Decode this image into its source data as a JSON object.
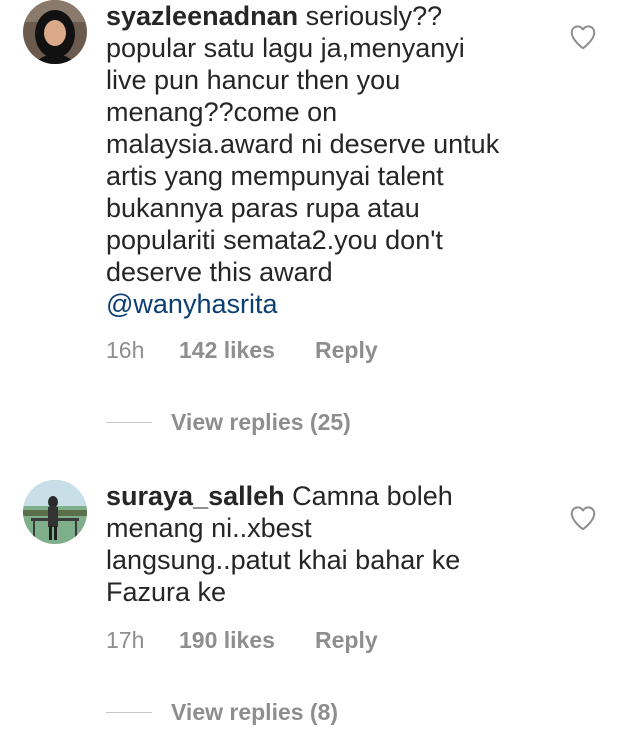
{
  "comments": [
    {
      "username": "syazleenadnan",
      "text": "seriously?? popular satu lagu ja,menyanyi live pun hancur then you menang??come on malaysia.award ni deserve untuk artis yang mempunyai talent bukannya paras rupa atau populariti semata2.you don't deserve this award",
      "lines": [
        "popular satu lagu ja,menyanyi",
        "live pun hancur then you",
        "menang??come on",
        "malaysia.award ni deserve untuk",
        "artis yang mempunyai talent",
        "bukannya paras rupa atau",
        "populariti semata2.you don't",
        "deserve this award"
      ],
      "first_line": "seriously??",
      "mention": "@wanyhasrita",
      "time": "16h",
      "likes": "142 likes",
      "reply_label": "Reply",
      "view_replies": "View replies (25)",
      "like_icon": "heart-outline-icon"
    },
    {
      "username": "suraya_salleh",
      "first_line": "Camna boleh",
      "lines": [
        "menang ni..xbest",
        "langsung..patut khai bahar ke",
        "Fazura ke"
      ],
      "time": "17h",
      "likes": "190 likes",
      "reply_label": "Reply",
      "view_replies": "View replies (8)",
      "like_icon": "heart-outline-icon"
    }
  ],
  "colors": {
    "text": "#262626",
    "secondary": "#8e8e8e",
    "mention": "#0b3f73",
    "divider": "#c7c7c7"
  }
}
